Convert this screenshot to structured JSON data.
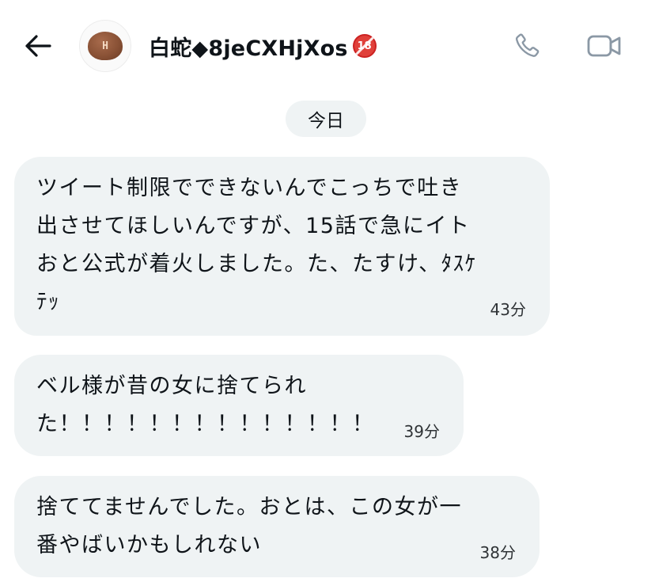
{
  "header": {
    "back_icon": "arrow-left-icon",
    "avatar_label": "H",
    "title": "白蛇◆8jeCXHjXos",
    "badge": "18",
    "phone_icon": "phone-icon",
    "video_icon": "video-camera-icon"
  },
  "date_separator": "今日",
  "messages": [
    {
      "text": "ツイート制限でできないんでこっちで吐き\n出させてほしいんですが、15話で急にイト\nおと公式が着火しました。た、たすけ、ﾀｽｹ\nﾃｯ",
      "time": "43分"
    },
    {
      "text": "ベル様が昔の女に捨てられ\nた！！！！！！！！！！！！！！",
      "time": "39分"
    },
    {
      "text": "捨ててませんでした。おとは、この女が一\n番やばいかもしれない",
      "time": "38分"
    }
  ],
  "colors": {
    "bubble_bg": "#eff3f4",
    "text": "#0f1419",
    "icon_gray": "#8b98a5"
  }
}
